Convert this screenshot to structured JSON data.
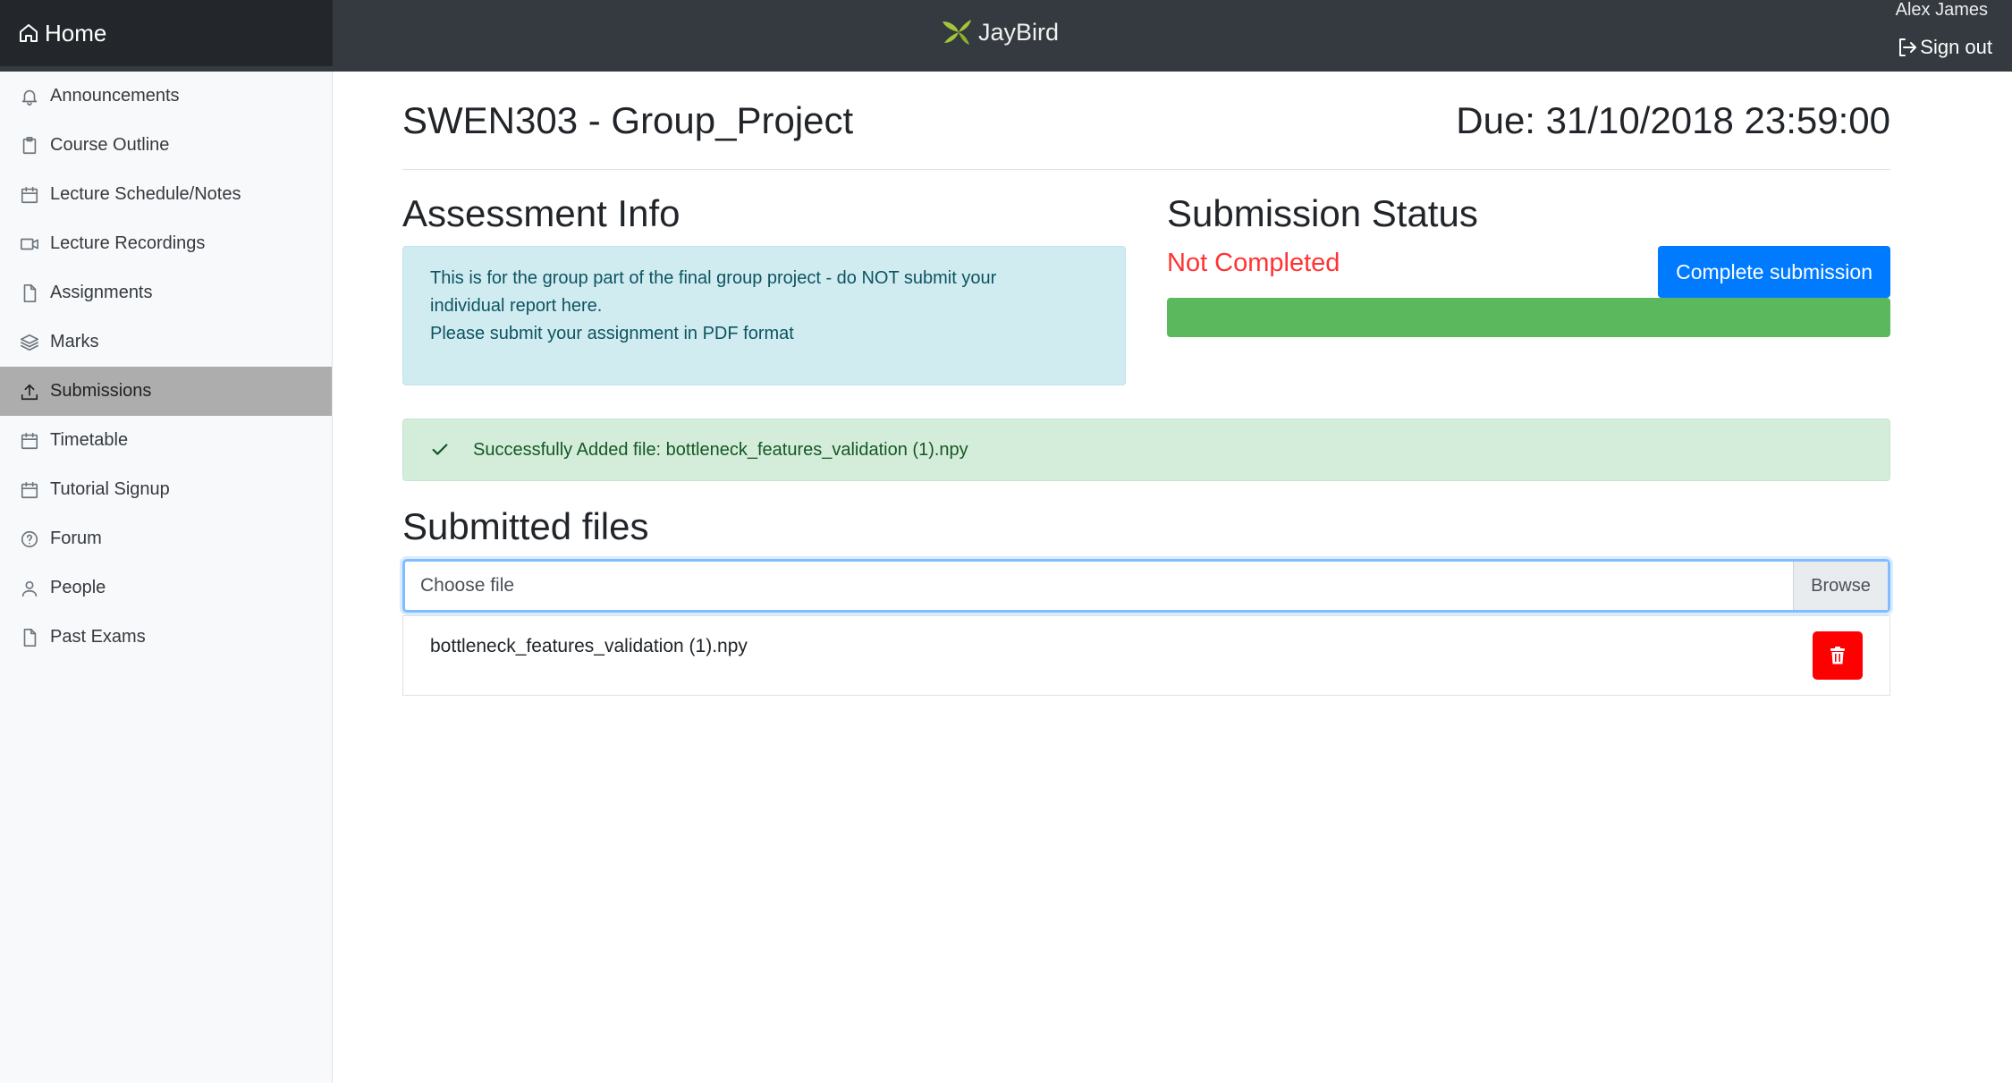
{
  "topbar": {
    "home_label": "Home",
    "brand_name": "JayBird",
    "user_name": "Alex James",
    "signout_label": "Sign out"
  },
  "sidebar": {
    "active_index": 6,
    "items": [
      {
        "label": "Announcements",
        "icon": "bell-icon"
      },
      {
        "label": "Course Outline",
        "icon": "clipboard-icon"
      },
      {
        "label": "Lecture Schedule/Notes",
        "icon": "calendar-icon"
      },
      {
        "label": "Lecture Recordings",
        "icon": "video-icon"
      },
      {
        "label": "Assignments",
        "icon": "file-icon"
      },
      {
        "label": "Marks",
        "icon": "layers-icon"
      },
      {
        "label": "Submissions",
        "icon": "upload-icon"
      },
      {
        "label": "Timetable",
        "icon": "calendar-icon"
      },
      {
        "label": "Tutorial Signup",
        "icon": "calendar-icon"
      },
      {
        "label": "Forum",
        "icon": "help-circle-icon"
      },
      {
        "label": "People",
        "icon": "user-icon"
      },
      {
        "label": "Past Exams",
        "icon": "file-icon"
      }
    ]
  },
  "main": {
    "title": "SWEN303 - Group_Project",
    "due": "Due: 31/10/2018 23:59:00",
    "assessment_heading": "Assessment Info",
    "assessment_lines": [
      "This is for the group part of the final group project - do NOT submit your",
      "individual report here.",
      "Please submit your assignment in PDF format"
    ],
    "status_heading": "Submission Status",
    "status_text": "Not Completed",
    "complete_button": "Complete submission",
    "progress_fraction": 1.0,
    "success_message": "Successfully Added file: bottleneck_features_validation (1).npy",
    "submitted_heading": "Submitted files",
    "file_input_placeholder": "Choose file",
    "browse_label": "Browse",
    "files": [
      "bottleneck_features_validation (1).npy"
    ]
  },
  "colors": {
    "topbar": "#343a40",
    "primary": "#007bff",
    "status_red": "#ff3333",
    "progress_green": "#5cb85c",
    "delete_red": "#ff0000",
    "brand_logo": "#a4c639"
  }
}
